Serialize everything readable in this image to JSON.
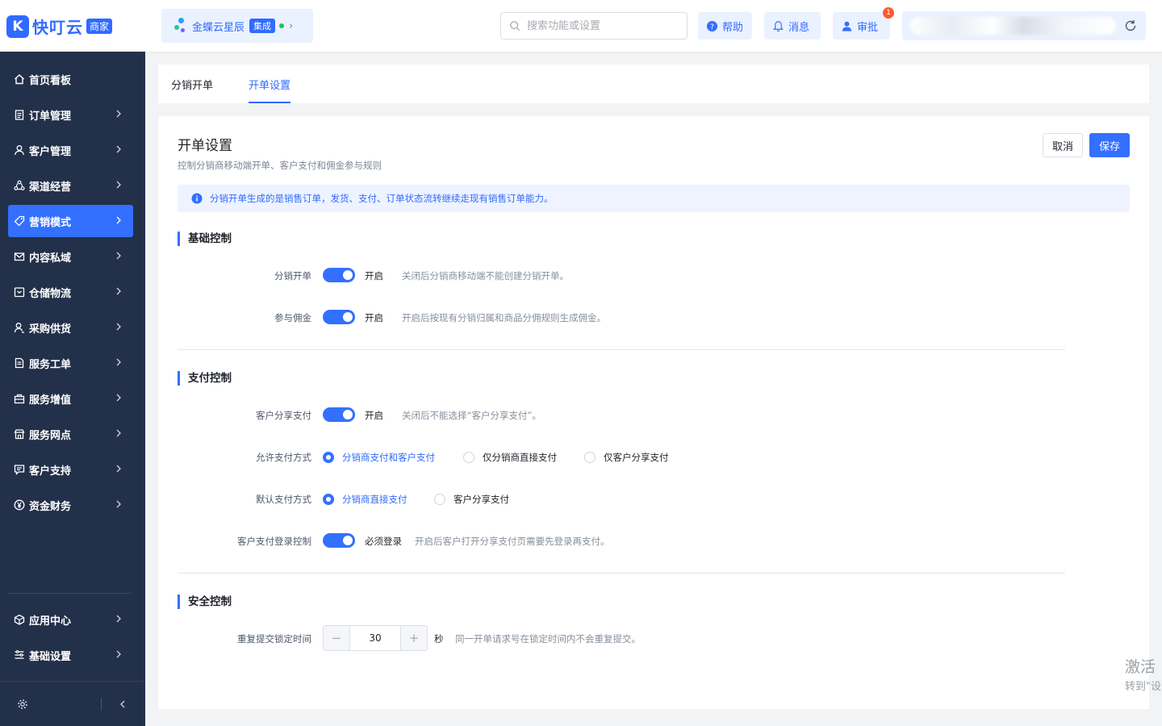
{
  "header": {
    "logo_text": "快叮云",
    "logo_badge": "商家",
    "product": {
      "name": "金蝶云星辰",
      "tag": "集成"
    },
    "search_placeholder": "搜索功能或设置",
    "help": "帮助",
    "messages": "消息",
    "approve": "审批",
    "approve_badge": "1"
  },
  "sidebar": {
    "items": [
      {
        "label": "首页看板",
        "icon": "home-icon"
      },
      {
        "label": "订单管理",
        "icon": "clipboard-icon"
      },
      {
        "label": "客户管理",
        "icon": "user-icon"
      },
      {
        "label": "渠道经营",
        "icon": "recycle-icon"
      },
      {
        "label": "营销模式",
        "icon": "tag-icon",
        "active": true
      },
      {
        "label": "内容私域",
        "icon": "mail-icon"
      },
      {
        "label": "仓储物流",
        "icon": "box-icon"
      },
      {
        "label": "采购供货",
        "icon": "person-icon"
      },
      {
        "label": "服务工单",
        "icon": "document-icon"
      },
      {
        "label": "服务增值",
        "icon": "bag-icon"
      },
      {
        "label": "服务网点",
        "icon": "store-icon"
      },
      {
        "label": "客户支持",
        "icon": "chat-icon"
      },
      {
        "label": "资金财务",
        "icon": "yen-icon"
      }
    ],
    "bottom_items": [
      {
        "label": "应用中心",
        "icon": "cube-icon"
      },
      {
        "label": "基础设置",
        "icon": "list-settings-icon"
      }
    ]
  },
  "tabs": [
    {
      "label": "分销开单"
    },
    {
      "label": "开单设置",
      "active": true
    }
  ],
  "main": {
    "title": "开单设置",
    "subtitle": "控制分销商移动端开单、客户支付和佣金参与规则",
    "cancel": "取消",
    "save": "保存",
    "notice": "分销开单生成的是销售订单，发货、支付、订单状态流转继续走现有销售订单能力。",
    "sections": {
      "basic": {
        "title": "基础控制",
        "rows": [
          {
            "label": "分销开单",
            "state": "开启",
            "hint": "关闭后分销商移动端不能创建分销开单。"
          },
          {
            "label": "参与佣金",
            "state": "开启",
            "hint": "开启后按现有分销归属和商品分佣规则生成佣金。"
          }
        ]
      },
      "payment": {
        "title": "支付控制",
        "share_pay": {
          "label": "客户分享支付",
          "state": "开启",
          "hint": "关闭后不能选择“客户分享支付”。"
        },
        "allowed": {
          "label": "允许支付方式",
          "options": [
            "分销商支付和客户支付",
            "仅分销商直接支付",
            "仅客户分享支付"
          ],
          "selected": 0
        },
        "default": {
          "label": "默认支付方式",
          "options": [
            "分销商直接支付",
            "客户分享支付"
          ],
          "selected": 0
        },
        "login": {
          "label": "客户支付登录控制",
          "state": "必须登录",
          "hint": "开启后客户打开分享支付页需要先登录再支付。"
        }
      },
      "security": {
        "title": "安全控制",
        "lock": {
          "label": "重复提交锁定时间",
          "value": "30",
          "unit": "秒",
          "hint": "同一开单请求号在锁定时间内不会重复提交。"
        }
      }
    }
  },
  "watermark": {
    "line1": "激活",
    "line2": "转到\"设"
  },
  "colors": {
    "accent": "#3370ff",
    "sidebar": "#23304a"
  }
}
